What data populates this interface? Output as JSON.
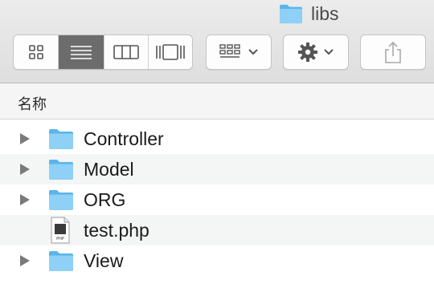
{
  "window": {
    "title": "libs",
    "title_icon": "folder-icon"
  },
  "toolbar": {
    "view_modes": [
      {
        "name": "icon-view",
        "icon": "grid-icon",
        "active": false
      },
      {
        "name": "list-view",
        "icon": "list-icon",
        "active": true
      },
      {
        "name": "column-view",
        "icon": "columns-icon",
        "active": false
      },
      {
        "name": "coverflow-view",
        "icon": "coverflow-icon",
        "active": false
      }
    ],
    "arrange_icon": "arrange-icon",
    "action_icon": "gear-icon",
    "share_icon": "share-icon"
  },
  "list": {
    "column_header": "名称",
    "rows": [
      {
        "name": "Controller",
        "type": "folder",
        "expandable": true
      },
      {
        "name": "Model",
        "type": "folder",
        "expandable": true
      },
      {
        "name": "ORG",
        "type": "folder",
        "expandable": true
      },
      {
        "name": "test.php",
        "type": "php-file",
        "expandable": false,
        "file_badge": "PHP"
      },
      {
        "name": "View",
        "type": "folder",
        "expandable": true
      }
    ]
  },
  "colors": {
    "folder": "#78c6f3",
    "active_segment": "#6c6c6c",
    "alt_row": "#f4f5f5"
  }
}
